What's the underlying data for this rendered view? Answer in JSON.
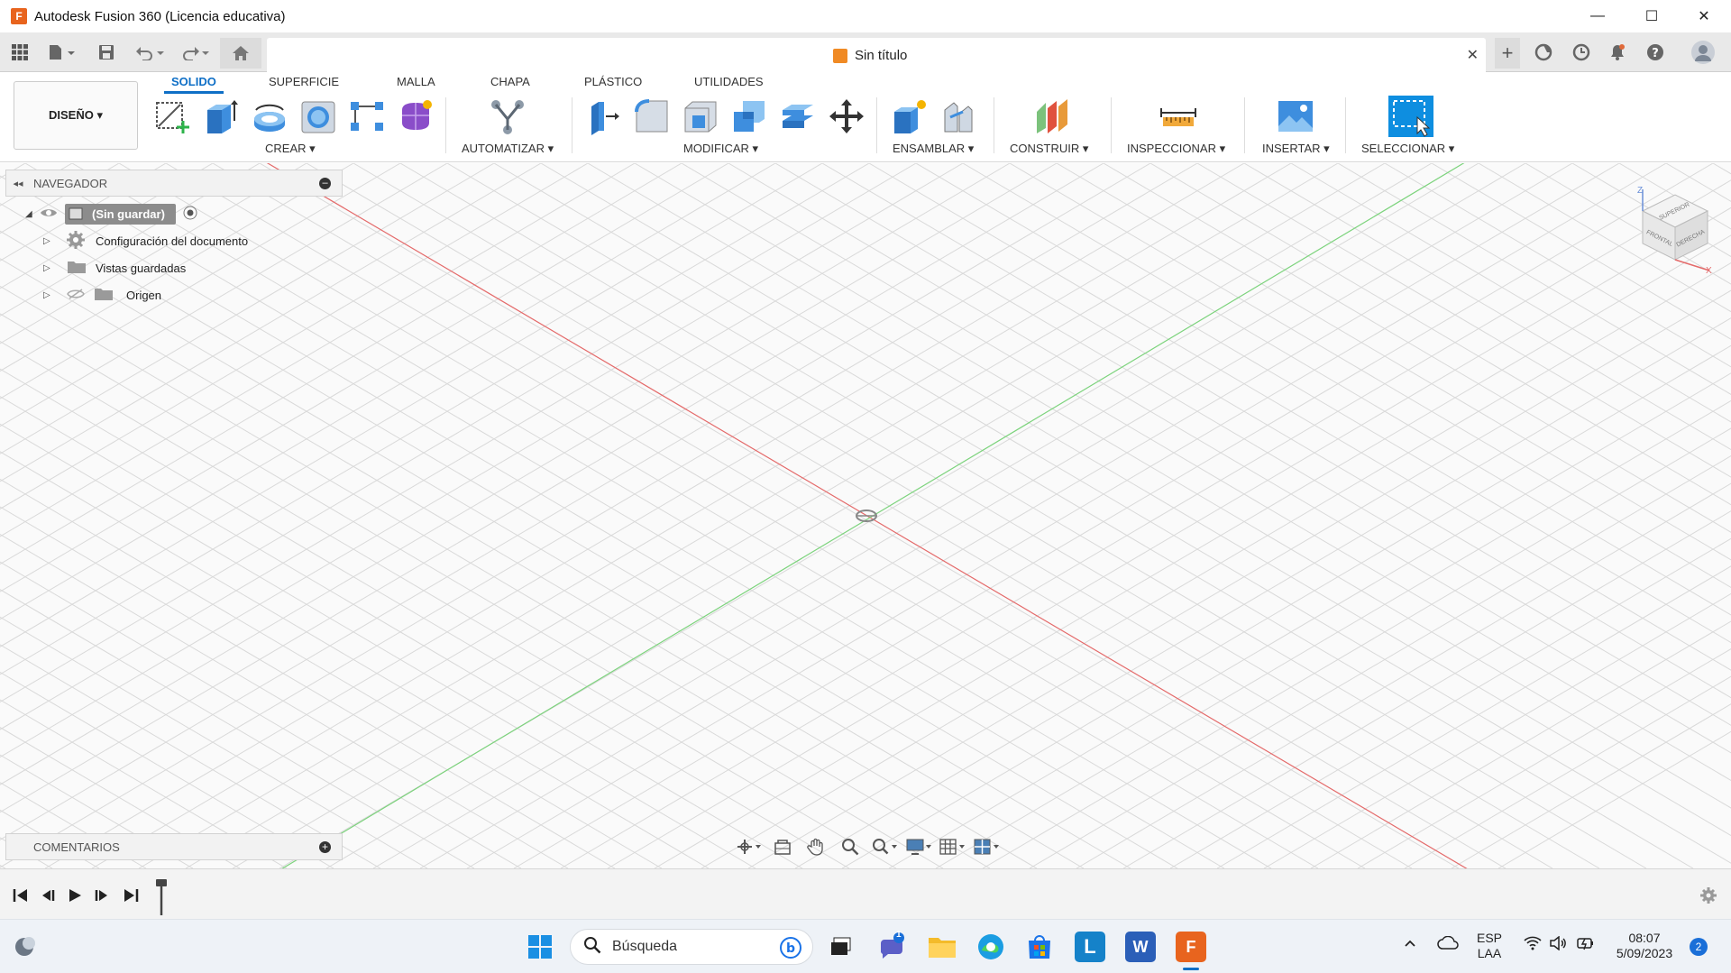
{
  "window": {
    "title": "Autodesk Fusion 360 (Licencia educativa)",
    "logo": "F",
    "minimize": "—",
    "maximize": "☐",
    "close": "✕"
  },
  "document": {
    "name": "Sin título",
    "close": "✕"
  },
  "ribbon": {
    "workspace": "DISEÑO ▾",
    "tabs": [
      "SOLIDO",
      "SUPERFICIE",
      "MALLA",
      "CHAPA",
      "PLÁSTICO",
      "UTILIDADES"
    ],
    "groups": [
      "CREAR ▾",
      "AUTOMATIZAR ▾",
      "MODIFICAR ▾",
      "ENSAMBLAR ▾",
      "CONSTRUIR ▾",
      "INSPECCIONAR ▾",
      "INSERTAR ▾",
      "SELECCIONAR ▾"
    ]
  },
  "navigator": {
    "title": "NAVEGADOR",
    "root": "(Sin guardar)",
    "items": [
      "Configuración del documento",
      "Vistas guardadas",
      "Origen"
    ]
  },
  "comments": {
    "title": "COMENTARIOS"
  },
  "viewcube": {
    "top": "SUPERIOR",
    "front": "FRONTAL",
    "right": "DERECHA",
    "axis_z": "Z",
    "axis_x": "X"
  },
  "taskbar": {
    "search_placeholder": "Búsqueda",
    "chat_badge": "1",
    "lang_top": "ESP",
    "lang_bottom": "LAA",
    "time": "08:07",
    "date": "5/09/2023",
    "notif_count": "2",
    "apps": [
      "L",
      "W",
      "F"
    ]
  },
  "colors": {
    "accent": "#0f6fc6",
    "x_axis": "#e46a6a",
    "y_axis": "#7cd37c",
    "fusion_orange": "#e8641e"
  }
}
